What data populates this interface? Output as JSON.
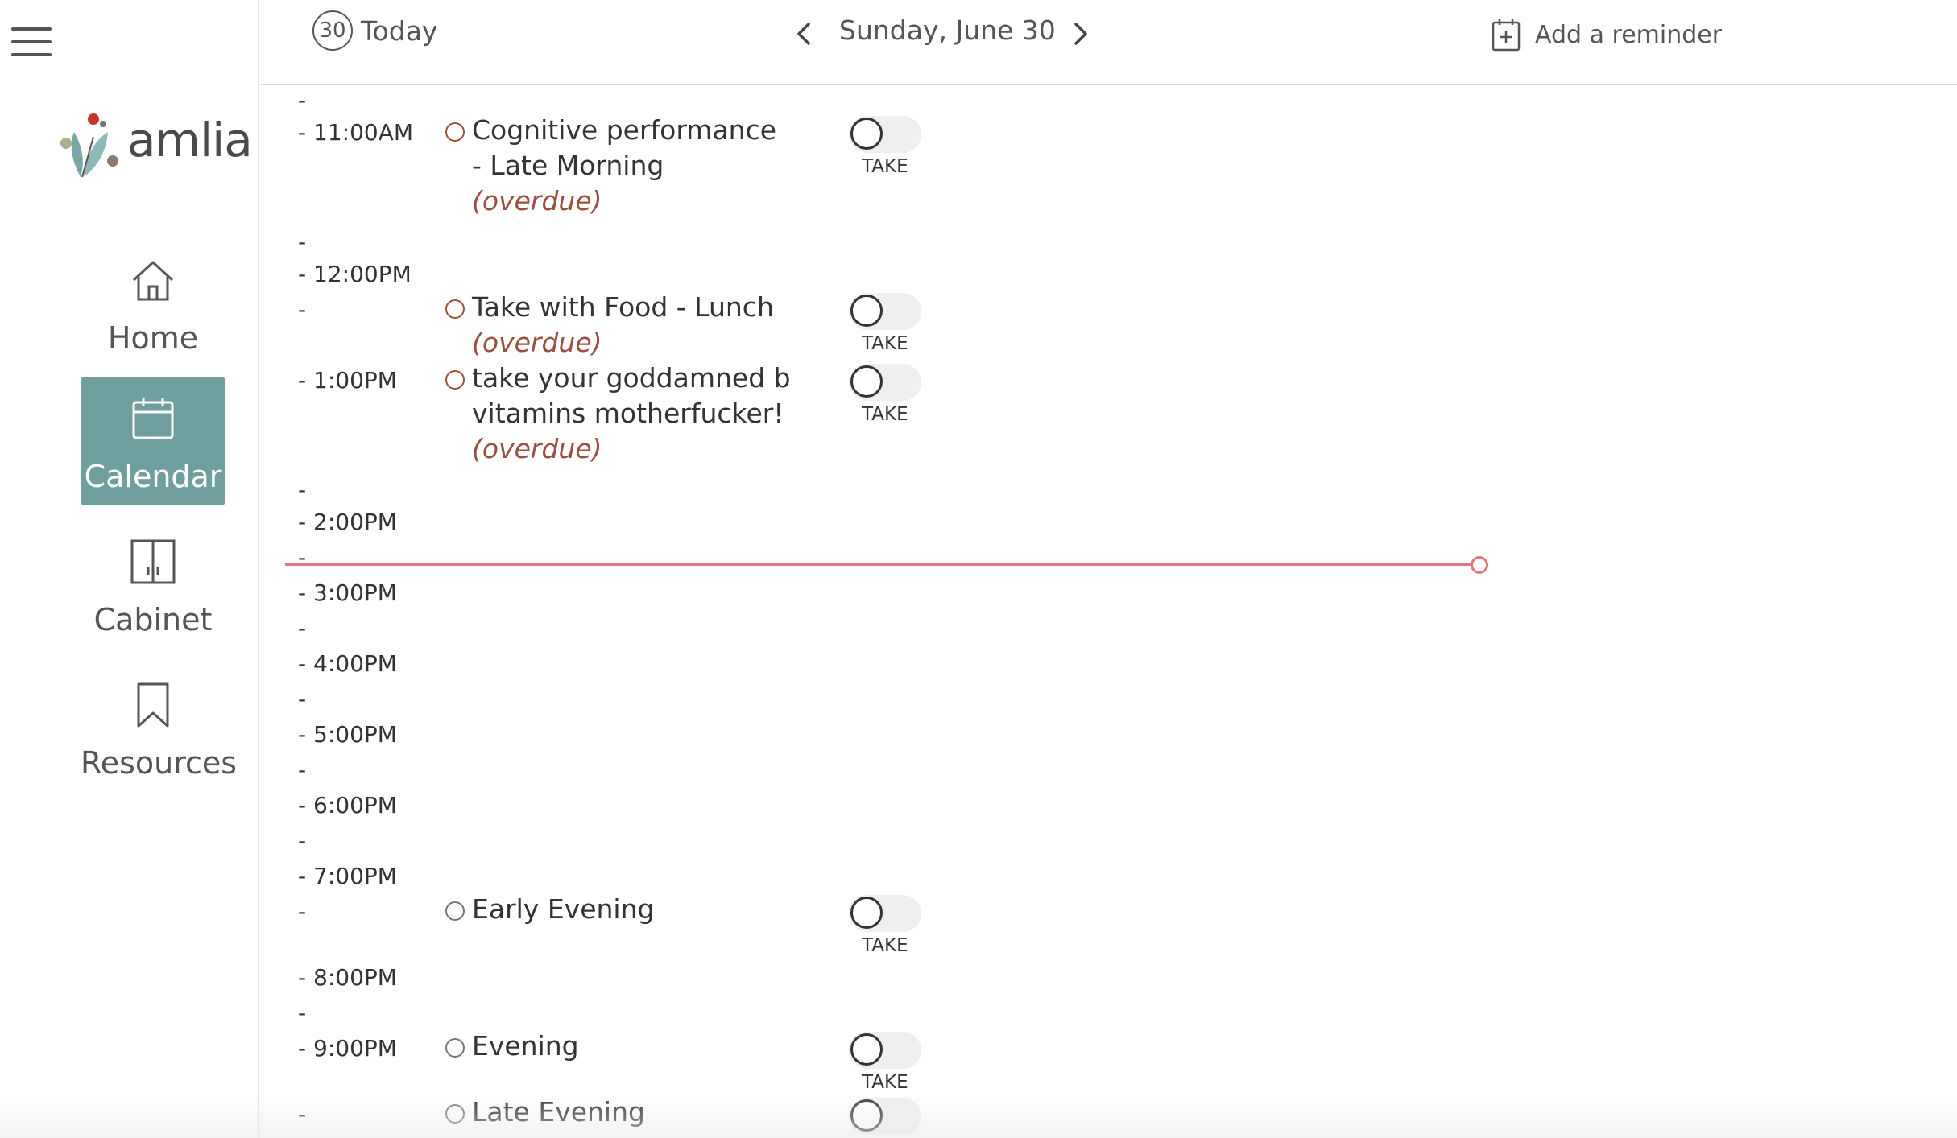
{
  "app": {
    "logo_text": "amlia"
  },
  "sidebar": {
    "items": [
      {
        "label": "Home",
        "icon": "home-icon",
        "active": false
      },
      {
        "label": "Calendar",
        "icon": "calendar-icon",
        "active": true
      },
      {
        "label": "Cabinet",
        "icon": "cabinet-icon",
        "active": false
      },
      {
        "label": "Resources",
        "icon": "bookmark-icon",
        "active": false
      }
    ]
  },
  "header": {
    "today_day": "30",
    "today_label": "Today",
    "date_label": "Sunday,  June 30",
    "add_reminder_label": "Add a reminder"
  },
  "colors": {
    "accent": "#6f9e9e",
    "overdue": "#9a5040",
    "now_line": "#e07880"
  },
  "schedule": {
    "ticks": [
      "-",
      "- 11:00AM",
      "-",
      "- 12:00PM",
      "-",
      "- 1:00PM",
      "-",
      "- 2:00PM",
      "-",
      "- 3:00PM",
      "-",
      "- 4:00PM",
      "-",
      "- 5:00PM",
      "-",
      "- 6:00PM",
      "-",
      "- 7:00PM",
      "-",
      "- 8:00PM",
      "-",
      "- 9:00PM",
      "-"
    ],
    "events": [
      {
        "title": "Cognitive performance - Late Morning",
        "status": "(overdue)",
        "action": "TAKE"
      },
      {
        "title": "Take with Food - Lunch",
        "status": "(overdue)",
        "action": "TAKE"
      },
      {
        "title": "take your goddamned b vitamins motherfucker!",
        "status": "(overdue)",
        "action": "TAKE"
      },
      {
        "title": "Early Evening",
        "status": "",
        "action": "TAKE"
      },
      {
        "title": "Evening",
        "status": "",
        "action": "TAKE"
      },
      {
        "title": "Late Evening",
        "status": "",
        "action": ""
      }
    ]
  }
}
